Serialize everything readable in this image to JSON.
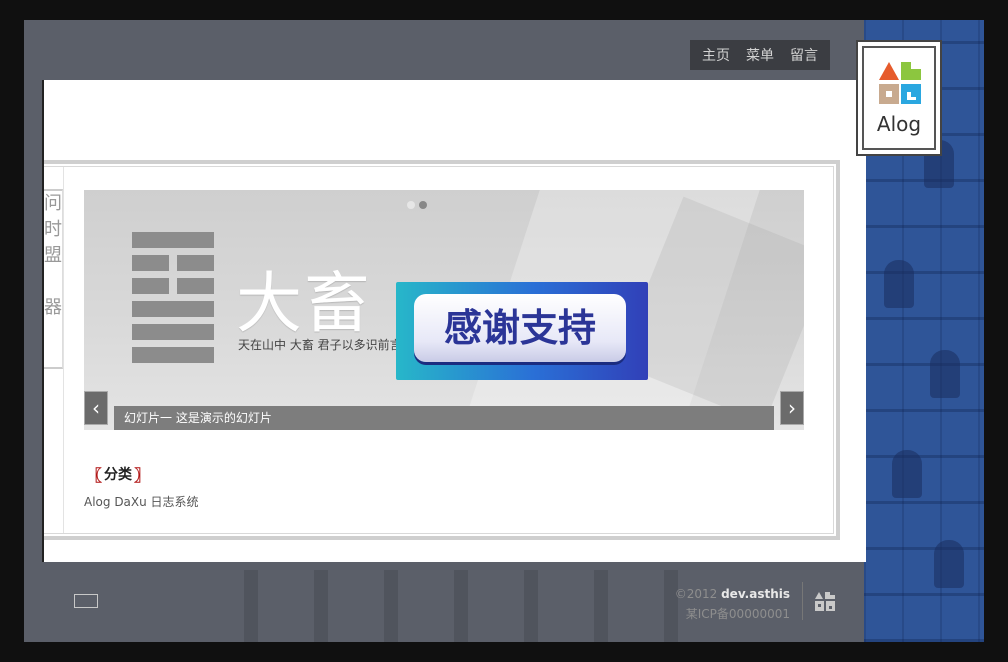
{
  "nav": {
    "items": [
      "主页",
      "菜单",
      "留言"
    ]
  },
  "logo": {
    "text": "Alog"
  },
  "slider": {
    "title": "大畜",
    "subtitle": "天在山中 大畜 君子以多识前言",
    "caption": "幻灯片一   这是演示的幻灯片",
    "prev_icon": "‹",
    "next_icon": "›"
  },
  "badge": {
    "text": "感谢支持"
  },
  "category": {
    "title": "分类",
    "bracket_left": "〖",
    "bracket_right": "〗",
    "text": "Alog DaXu 日志系统"
  },
  "left_strip": {
    "chars": "问\n时\n盟\n\n器"
  },
  "footer": {
    "year": "©2012",
    "author": "dev.asthis",
    "icp": "某ICP备00000001"
  },
  "colors": {
    "accent_red": "#b01212",
    "panel_blue": "#2f5598",
    "badge_blue": "#2a6fd6"
  }
}
